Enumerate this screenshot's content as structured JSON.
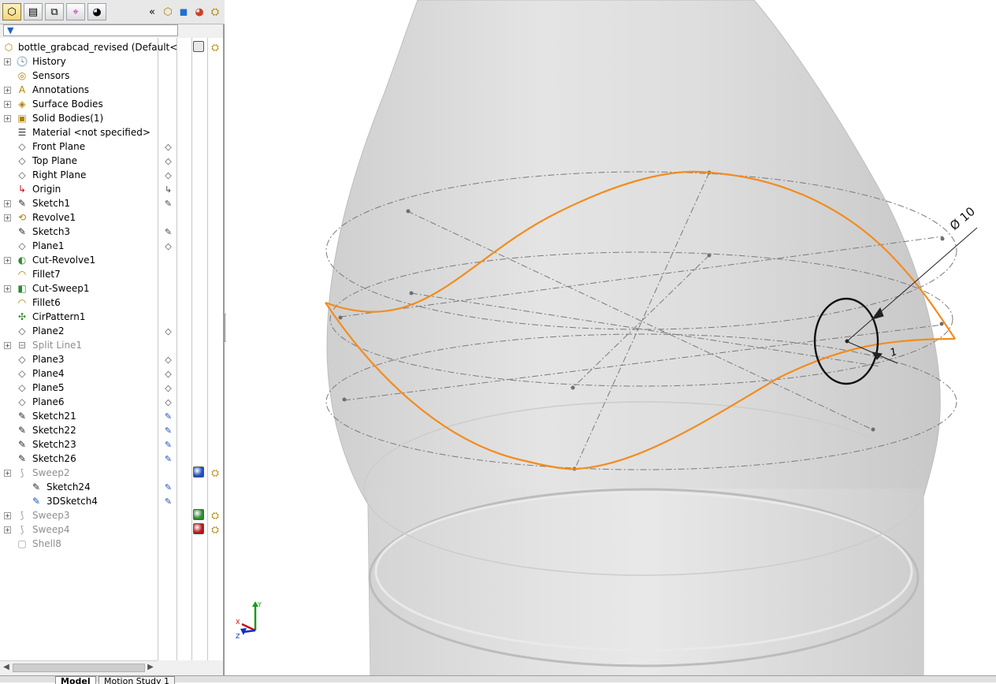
{
  "toolbar": {
    "tabs": [
      {
        "name": "featuremanager-tab",
        "icon": "feature-manager-icon",
        "glyph": "⬡"
      },
      {
        "name": "propertymanager-tab",
        "icon": "property-manager-icon",
        "glyph": "▤"
      },
      {
        "name": "configurationmanager-tab",
        "icon": "configuration-manager-icon",
        "glyph": "⧉"
      },
      {
        "name": "dimxpert-tab",
        "icon": "dimxpert-icon",
        "glyph": "⌖"
      },
      {
        "name": "displaymanager-tab",
        "icon": "display-manager-icon",
        "glyph": "◕"
      }
    ],
    "collapse_glyph": "«"
  },
  "tree": {
    "root_label": "bottle_grabcad_revised  (Default<",
    "items": [
      {
        "label": "History",
        "icon": "history-folder-icon",
        "glyph": "🕓",
        "expandable": true,
        "indent": 0,
        "greyed": false
      },
      {
        "label": "Sensors",
        "icon": "sensors-folder-icon",
        "glyph": "◎",
        "expandable": false,
        "indent": 0,
        "greyed": false
      },
      {
        "label": "Annotations",
        "icon": "annotations-folder-icon",
        "glyph": "A",
        "expandable": true,
        "indent": 0,
        "greyed": false
      },
      {
        "label": "Surface Bodies",
        "icon": "surface-bodies-folder-icon",
        "glyph": "◈",
        "expandable": true,
        "indent": 0,
        "greyed": false
      },
      {
        "label": "Solid Bodies(1)",
        "icon": "solid-bodies-folder-icon",
        "glyph": "▣",
        "expandable": true,
        "indent": 0,
        "greyed": false
      },
      {
        "label": "Material <not specified>",
        "icon": "material-icon",
        "glyph": "☰",
        "expandable": false,
        "indent": 0,
        "greyed": false
      },
      {
        "label": "Front Plane",
        "icon": "plane-icon",
        "glyph": "◇",
        "expandable": false,
        "indent": 0,
        "greyed": false
      },
      {
        "label": "Top Plane",
        "icon": "plane-icon",
        "glyph": "◇",
        "expandable": false,
        "indent": 0,
        "greyed": false
      },
      {
        "label": "Right Plane",
        "icon": "plane-icon",
        "glyph": "◇",
        "expandable": false,
        "indent": 0,
        "greyed": false
      },
      {
        "label": "Origin",
        "icon": "origin-icon",
        "glyph": "↳",
        "expandable": false,
        "indent": 0,
        "greyed": false
      },
      {
        "label": "Sketch1",
        "icon": "sketch-icon",
        "glyph": "✎",
        "expandable": true,
        "indent": 0,
        "greyed": false
      },
      {
        "label": "Revolve1",
        "icon": "revolve-icon",
        "glyph": "⟲",
        "expandable": true,
        "indent": 0,
        "greyed": false
      },
      {
        "label": "Sketch3",
        "icon": "sketch-icon",
        "glyph": "✎",
        "expandable": false,
        "indent": 0,
        "greyed": false
      },
      {
        "label": "Plane1",
        "icon": "plane-icon",
        "glyph": "◇",
        "expandable": false,
        "indent": 0,
        "greyed": false
      },
      {
        "label": "Cut-Revolve1",
        "icon": "cut-revolve-icon",
        "glyph": "◐",
        "expandable": true,
        "indent": 0,
        "greyed": false
      },
      {
        "label": "Fillet7",
        "icon": "fillet-icon",
        "glyph": "◠",
        "expandable": false,
        "indent": 0,
        "greyed": false
      },
      {
        "label": "Cut-Sweep1",
        "icon": "cut-sweep-icon",
        "glyph": "◧",
        "expandable": true,
        "indent": 0,
        "greyed": false
      },
      {
        "label": "Fillet6",
        "icon": "fillet-icon",
        "glyph": "◠",
        "expandable": false,
        "indent": 0,
        "greyed": false
      },
      {
        "label": "CirPattern1",
        "icon": "circular-pattern-icon",
        "glyph": "✣",
        "expandable": false,
        "indent": 0,
        "greyed": false
      },
      {
        "label": "Plane2",
        "icon": "plane-icon",
        "glyph": "◇",
        "expandable": false,
        "indent": 0,
        "greyed": false
      },
      {
        "label": "Split Line1",
        "icon": "split-line-icon",
        "glyph": "⊟",
        "expandable": true,
        "indent": 0,
        "greyed": true
      },
      {
        "label": "Plane3",
        "icon": "plane-icon",
        "glyph": "◇",
        "expandable": false,
        "indent": 0,
        "greyed": false
      },
      {
        "label": "Plane4",
        "icon": "plane-icon",
        "glyph": "◇",
        "expandable": false,
        "indent": 0,
        "greyed": false
      },
      {
        "label": "Plane5",
        "icon": "plane-icon",
        "glyph": "◇",
        "expandable": false,
        "indent": 0,
        "greyed": false
      },
      {
        "label": "Plane6",
        "icon": "plane-icon",
        "glyph": "◇",
        "expandable": false,
        "indent": 0,
        "greyed": false
      },
      {
        "label": "Sketch21",
        "icon": "sketch-icon",
        "glyph": "✎",
        "expandable": false,
        "indent": 0,
        "greyed": false
      },
      {
        "label": "Sketch22",
        "icon": "sketch-icon",
        "glyph": "✎",
        "expandable": false,
        "indent": 0,
        "greyed": false
      },
      {
        "label": "Sketch23",
        "icon": "sketch-icon",
        "glyph": "✎",
        "expandable": false,
        "indent": 0,
        "greyed": false
      },
      {
        "label": "Sketch26",
        "icon": "sketch-icon",
        "glyph": "✎",
        "expandable": false,
        "indent": 0,
        "greyed": false
      },
      {
        "label": "Sweep2",
        "icon": "sweep-icon",
        "glyph": "⟆",
        "expandable": true,
        "indent": 0,
        "greyed": true
      },
      {
        "label": "Sketch24",
        "icon": "sketch-icon",
        "glyph": "✎",
        "expandable": false,
        "indent": 1,
        "greyed": false
      },
      {
        "label": "3DSketch4",
        "icon": "3d-sketch-icon",
        "glyph": "✎",
        "expandable": false,
        "indent": 1,
        "greyed": false
      },
      {
        "label": "Sweep3",
        "icon": "sweep-icon",
        "glyph": "⟆",
        "expandable": true,
        "indent": 0,
        "greyed": true
      },
      {
        "label": "Sweep4",
        "icon": "sweep-icon",
        "glyph": "⟆",
        "expandable": true,
        "indent": 0,
        "greyed": true
      },
      {
        "label": "Shell8",
        "icon": "shell-icon",
        "glyph": "▢",
        "expandable": false,
        "indent": 0,
        "greyed": true
      }
    ]
  },
  "bottom_tabs": [
    "Model",
    "Motion Study 1"
  ],
  "viewport": {
    "dimension_label": "Ø 10",
    "small_dimension": "1",
    "sketch_color": "#f28c1e",
    "body_color": "#d9d9d9",
    "triad_axes": [
      "Y",
      "X",
      "Z"
    ]
  }
}
